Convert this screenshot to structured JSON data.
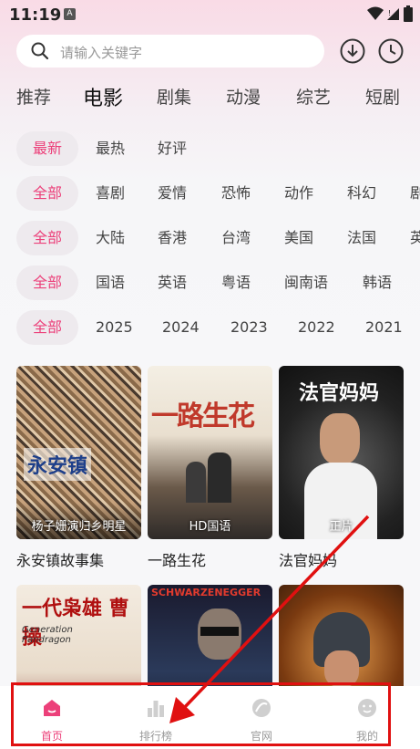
{
  "status": {
    "time": "11:19",
    "sim_badge": "A"
  },
  "search": {
    "placeholder": "请输入关键字"
  },
  "main_tabs": [
    "推荐",
    "电影",
    "剧集",
    "动漫",
    "综艺",
    "短剧"
  ],
  "filters": {
    "sort": [
      "最新",
      "最热",
      "好评"
    ],
    "genre": [
      "全部",
      "喜剧",
      "爱情",
      "恐怖",
      "动作",
      "科幻",
      "剧"
    ],
    "region": [
      "全部",
      "大陆",
      "香港",
      "台湾",
      "美国",
      "法国",
      "英"
    ],
    "language": [
      "全部",
      "国语",
      "英语",
      "粤语",
      "闽南语",
      "韩语"
    ],
    "year": [
      "全部",
      "2025",
      "2024",
      "2023",
      "2022",
      "2021"
    ]
  },
  "cards": [
    {
      "caption": "杨子姗演归乡明星",
      "title": "永安镇故事集",
      "poster_text": "永安镇"
    },
    {
      "caption": "HD国语",
      "title": "一路生花",
      "poster_text": "一路生花"
    },
    {
      "caption": "正片",
      "title": "法官妈妈",
      "poster_text": "法官妈妈"
    },
    {
      "caption": "",
      "title": "",
      "poster_text": "一代枭雄 曹操",
      "poster_sub": "Generation Pandragon"
    },
    {
      "caption": "",
      "title": "",
      "poster_text": "SCHWARZENEGGER"
    },
    {
      "caption": "",
      "title": "",
      "poster_text": ""
    }
  ],
  "bottom_nav": [
    {
      "label": "首页",
      "icon": "home-icon",
      "active": true
    },
    {
      "label": "排行榜",
      "icon": "ranking-icon",
      "active": false
    },
    {
      "label": "官网",
      "icon": "website-icon",
      "active": false
    },
    {
      "label": "我的",
      "icon": "profile-icon",
      "active": false
    }
  ],
  "colors": {
    "accent": "#ec407a",
    "annotation": "#e01010"
  }
}
